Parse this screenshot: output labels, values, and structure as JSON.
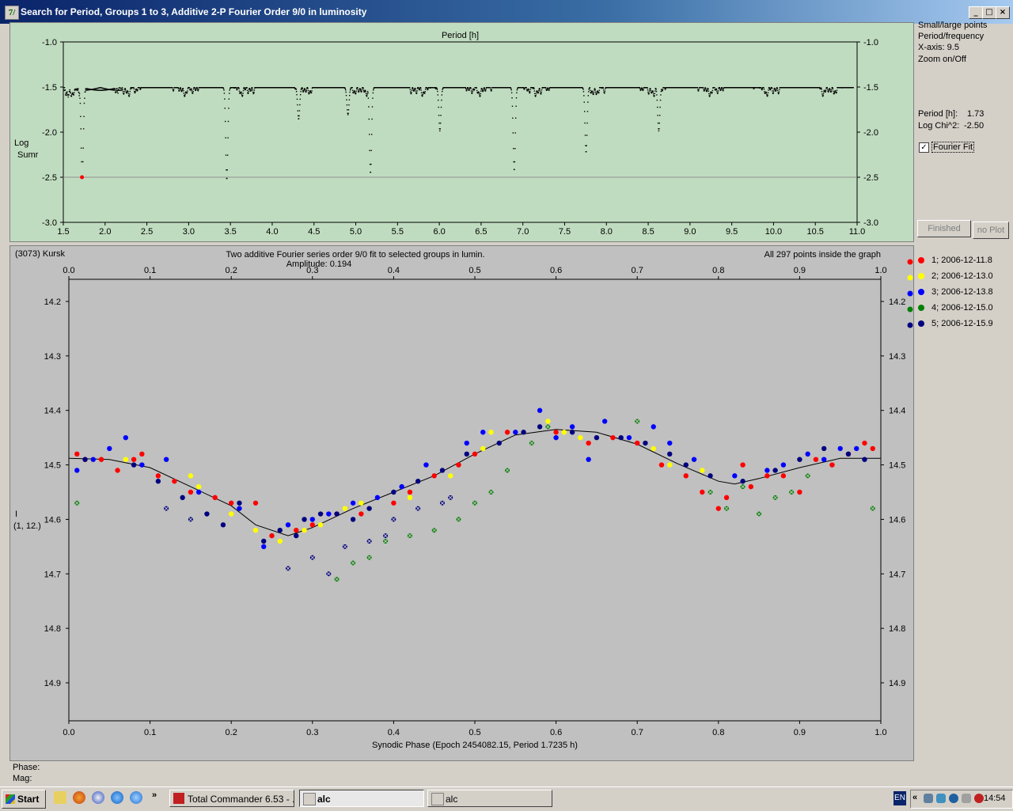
{
  "window": {
    "title": "Search for Period, Groups 1 to 3, Additive 2-P Fourier Order 9/0 in luminosity",
    "app_icon_label": "7/",
    "buttons": {
      "minimize": "_",
      "maximize": "□",
      "close": "×"
    }
  },
  "sidebar": {
    "lines": [
      "Small/large points",
      "Period/frequency",
      "X-axis: 9.5",
      "Zoom on/Off"
    ],
    "period_label": "Period [h]:",
    "period_value": "1.73",
    "logchi_label": "Log Chi^2:",
    "logchi_value": "-2.50",
    "fourier_fit_label": "Fourier Fit",
    "fourier_fit_checked": true,
    "check_mark": "✓",
    "finished_button": "Finished",
    "noplot_button": "no Plot"
  },
  "footer": {
    "phase_label": "Phase:",
    "mag_label": "Mag:"
  },
  "taskbar": {
    "start": "Start",
    "quick_more": "»",
    "tasks": [
      {
        "label": "Total Commander 6.53 - ...",
        "active": false
      },
      {
        "label": "alc",
        "active": true
      },
      {
        "label": "alc",
        "active": false
      }
    ],
    "language": "EN",
    "tray_arrows": "«",
    "clock": "14:54"
  },
  "chart_data": [
    {
      "type": "scatter",
      "name_on_chart": "periodogram",
      "title": "Period [h]",
      "ylabel_line1": "Log",
      "ylabel_line2": "Sumr",
      "xlim": [
        1.5,
        11.0
      ],
      "ylim": [
        -3.0,
        -1.0
      ],
      "x_ticks": [
        "1.5",
        "2.0",
        "2.5",
        "3.0",
        "3.5",
        "4.0",
        "4.5",
        "5.0",
        "5.5",
        "6.0",
        "6.5",
        "7.0",
        "7.5",
        "8.0",
        "8.5",
        "9.0",
        "9.5",
        "10.0",
        "10.5",
        "11.0"
      ],
      "y_ticks": [
        "-1.0",
        "-1.5",
        "-2.0",
        "-2.5",
        "-3.0"
      ],
      "reference_line": -2.5,
      "best_period": {
        "x": 1.7235,
        "y": -2.5,
        "color": "#ff0000"
      },
      "dips": [
        {
          "x": 1.72,
          "y": -2.5
        },
        {
          "x": 3.45,
          "y": -2.52
        },
        {
          "x": 5.17,
          "y": -2.45
        },
        {
          "x": 6.89,
          "y": -2.42
        },
        {
          "x": 7.75,
          "y": -2.22
        },
        {
          "x": 8.62,
          "y": -1.98
        },
        {
          "x": 6.0,
          "y": -1.98
        },
        {
          "x": 4.31,
          "y": -1.85
        },
        {
          "x": 4.9,
          "y": -1.8
        }
      ]
    },
    {
      "type": "scatter",
      "name_on_chart": "lightcurve",
      "header_left": "(3073) Kursk",
      "title": "Two additive Fourier series order 9/0 fit to selected groups in lumin.",
      "subtitle": "Amplitude: 0.194",
      "header_right": "All 297 points inside the graph",
      "xlabel": "Synodic Phase (Epoch 2454082.15, Period 1.7235 h)",
      "ylabel_line1": "I",
      "ylabel_line2": "(1, 12.)",
      "xlim": [
        0.0,
        1.0
      ],
      "ylim": [
        14.9,
        14.2
      ],
      "y_inverted": true,
      "x_ticks": [
        "0.0",
        "0.1",
        "0.2",
        "0.3",
        "0.4",
        "0.5",
        "0.6",
        "0.7",
        "0.8",
        "0.9",
        "1.0"
      ],
      "y_ticks": [
        "14.2",
        "14.3",
        "14.4",
        "14.5",
        "14.6",
        "14.7",
        "14.8",
        "14.9"
      ],
      "fit_curve": {
        "x": [
          0.0,
          0.05,
          0.1,
          0.15,
          0.2,
          0.23,
          0.27,
          0.3,
          0.35,
          0.4,
          0.45,
          0.5,
          0.55,
          0.6,
          0.65,
          0.7,
          0.75,
          0.8,
          0.82,
          0.85,
          0.9,
          0.95,
          1.0
        ],
        "y": [
          14.488,
          14.49,
          14.505,
          14.54,
          14.575,
          14.61,
          14.63,
          14.615,
          14.58,
          14.55,
          14.52,
          14.48,
          14.445,
          14.435,
          14.44,
          14.462,
          14.498,
          14.53,
          14.535,
          14.525,
          14.505,
          14.488,
          14.488
        ]
      },
      "series": [
        {
          "name": "1; 2006-12-11.8",
          "color": "#ff0000",
          "x": [
            0.01,
            0.02,
            0.04,
            0.06,
            0.08,
            0.09,
            0.11,
            0.13,
            0.15,
            0.18,
            0.2,
            0.23,
            0.25,
            0.28,
            0.3,
            0.33,
            0.36,
            0.4,
            0.42,
            0.45,
            0.48,
            0.5,
            0.54,
            0.6,
            0.64,
            0.67,
            0.7,
            0.73,
            0.76,
            0.78,
            0.8,
            0.81,
            0.83,
            0.84,
            0.86,
            0.88,
            0.9,
            0.92,
            0.94,
            0.96,
            0.98,
            0.99
          ],
          "y": [
            14.48,
            14.49,
            14.49,
            14.51,
            14.49,
            14.48,
            14.52,
            14.53,
            14.55,
            14.56,
            14.57,
            14.57,
            14.63,
            14.62,
            14.61,
            14.59,
            14.59,
            14.57,
            14.55,
            14.52,
            14.5,
            14.48,
            14.44,
            14.44,
            14.46,
            14.45,
            14.46,
            14.5,
            14.52,
            14.55,
            14.58,
            14.56,
            14.5,
            14.54,
            14.52,
            14.52,
            14.55,
            14.49,
            14.5,
            14.48,
            14.46,
            14.47
          ]
        },
        {
          "name": "2; 2006-12-13.0",
          "color": "#ffff00",
          "x": [
            0.03,
            0.07,
            0.15,
            0.16,
            0.2,
            0.23,
            0.26,
            0.29,
            0.31,
            0.34,
            0.36,
            0.42,
            0.47,
            0.51,
            0.52,
            0.59,
            0.61,
            0.63,
            0.72,
            0.74,
            0.78
          ],
          "y": [
            14.49,
            14.49,
            14.52,
            14.54,
            14.59,
            14.62,
            14.64,
            14.62,
            14.61,
            14.58,
            14.57,
            14.56,
            14.52,
            14.47,
            14.44,
            14.42,
            14.44,
            14.45,
            14.47,
            14.5,
            14.51
          ]
        },
        {
          "name": "3; 2006-12-13.8",
          "color": "#0000ff",
          "x": [
            0.01,
            0.03,
            0.05,
            0.07,
            0.09,
            0.12,
            0.16,
            0.21,
            0.24,
            0.27,
            0.3,
            0.32,
            0.35,
            0.38,
            0.41,
            0.44,
            0.49,
            0.51,
            0.55,
            0.58,
            0.6,
            0.62,
            0.64,
            0.66,
            0.69,
            0.72,
            0.74,
            0.77,
            0.82,
            0.86,
            0.88,
            0.91,
            0.93,
            0.95,
            0.97
          ],
          "y": [
            14.51,
            14.49,
            14.47,
            14.45,
            14.5,
            14.49,
            14.55,
            14.58,
            14.65,
            14.61,
            14.6,
            14.59,
            14.57,
            14.56,
            14.54,
            14.5,
            14.46,
            14.44,
            14.44,
            14.4,
            14.45,
            14.43,
            14.49,
            14.42,
            14.45,
            14.43,
            14.46,
            14.49,
            14.52,
            14.51,
            14.5,
            14.48,
            14.49,
            14.47,
            14.47
          ]
        },
        {
          "name": "4; 2006-12-15.0",
          "color": "#008000",
          "x": [
            0.01,
            0.33,
            0.35,
            0.37,
            0.39,
            0.42,
            0.45,
            0.48,
            0.5,
            0.52,
            0.54,
            0.57,
            0.59,
            0.7,
            0.79,
            0.81,
            0.83,
            0.85,
            0.87,
            0.89,
            0.91,
            0.99
          ],
          "y": [
            14.57,
            14.71,
            14.68,
            14.67,
            14.64,
            14.63,
            14.62,
            14.6,
            14.57,
            14.55,
            14.51,
            14.46,
            14.43,
            14.42,
            14.55,
            14.58,
            14.54,
            14.59,
            14.56,
            14.55,
            14.52,
            14.58
          ],
          "marker": "cross"
        },
        {
          "name": "5; 2006-12-15.9",
          "color": "#000080",
          "x": [
            0.02,
            0.08,
            0.11,
            0.14,
            0.17,
            0.19,
            0.21,
            0.24,
            0.26,
            0.28,
            0.29,
            0.31,
            0.33,
            0.35,
            0.37,
            0.4,
            0.43,
            0.46,
            0.49,
            0.53,
            0.56,
            0.58,
            0.62,
            0.65,
            0.68,
            0.71,
            0.74,
            0.76,
            0.79,
            0.83,
            0.87,
            0.9,
            0.93,
            0.96,
            0.98
          ],
          "y": [
            14.49,
            14.5,
            14.53,
            14.56,
            14.59,
            14.61,
            14.57,
            14.64,
            14.62,
            14.63,
            14.6,
            14.59,
            14.59,
            14.6,
            14.58,
            14.55,
            14.53,
            14.51,
            14.48,
            14.46,
            14.44,
            14.43,
            14.44,
            14.45,
            14.45,
            14.46,
            14.48,
            14.5,
            14.52,
            14.53,
            14.51,
            14.49,
            14.47,
            14.48,
            14.49
          ]
        },
        {
          "name": "",
          "color": "#000080",
          "x": [
            0.12,
            0.15,
            0.27,
            0.3,
            0.32,
            0.34,
            0.37,
            0.39,
            0.4,
            0.43,
            0.46,
            0.47
          ],
          "y": [
            14.58,
            14.6,
            14.69,
            14.67,
            14.7,
            14.65,
            14.64,
            14.63,
            14.6,
            14.58,
            14.57,
            14.56
          ],
          "marker": "cross"
        }
      ],
      "legend_placement": "right"
    }
  ]
}
